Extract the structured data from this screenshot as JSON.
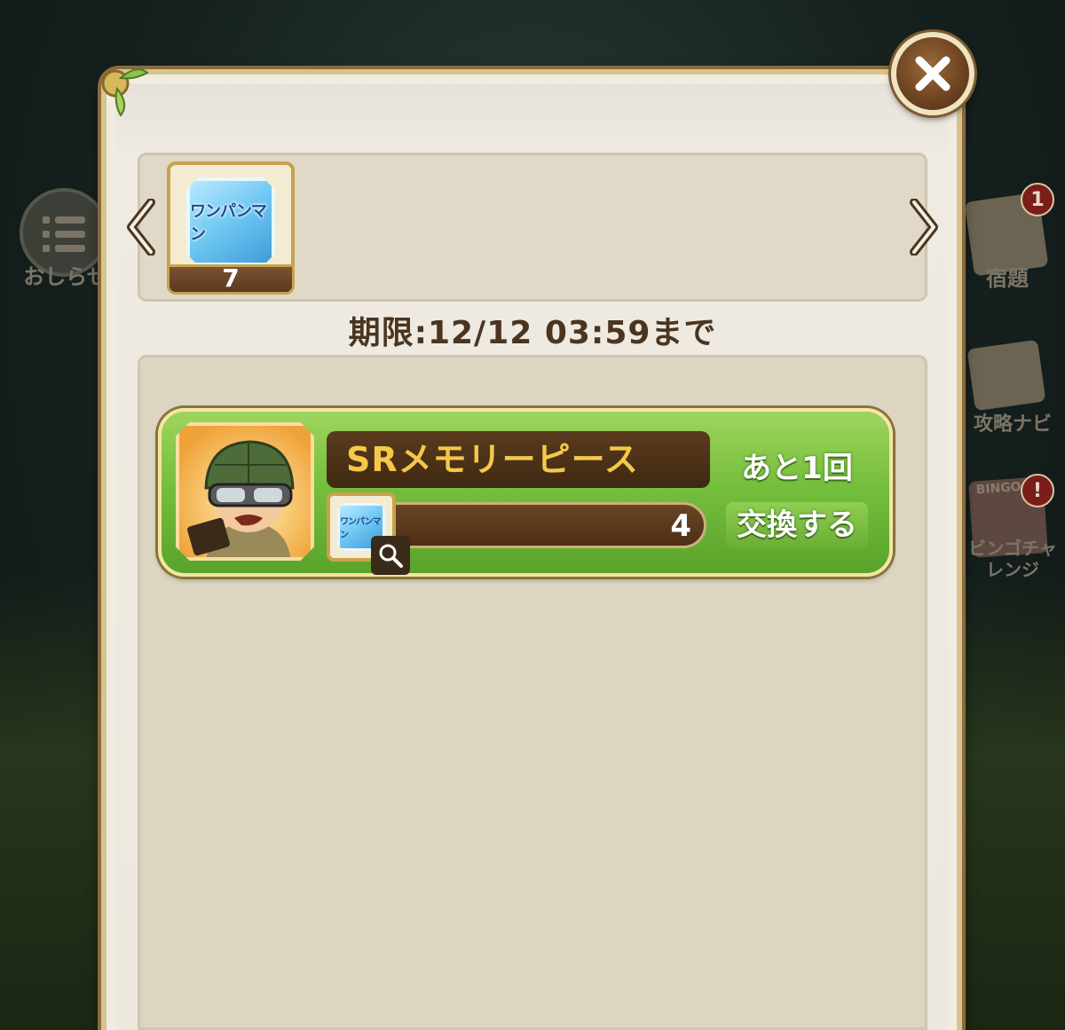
{
  "background": {
    "left_menu_label": "おしらせ",
    "right_menu": [
      {
        "label": "宿題",
        "badge": "1"
      },
      {
        "label": "攻略ナビ"
      },
      {
        "label": "ビンゴチャレンジ",
        "badge": "!",
        "sub_label": "BINGO"
      }
    ]
  },
  "panel": {
    "close_label": "×",
    "currency": {
      "name": "ワンパンマン",
      "count": "7"
    },
    "deadline": "期限:12/12 03:59まで",
    "items": [
      {
        "name": "SRメモリーピース",
        "remaining": "あと1回",
        "cost_currency": "ワンパンマン",
        "cost": "4",
        "exchange_label": "交換する"
      }
    ]
  },
  "colors": {
    "accent_green": "#76bf3d",
    "brown": "#5a3b1e",
    "gold": "#f4c84a",
    "panel_border": "#d6c48f"
  },
  "icons": {
    "close": "close-icon",
    "prev": "chevron-left-icon",
    "next": "chevron-right-icon",
    "zoom": "magnifier-icon"
  }
}
